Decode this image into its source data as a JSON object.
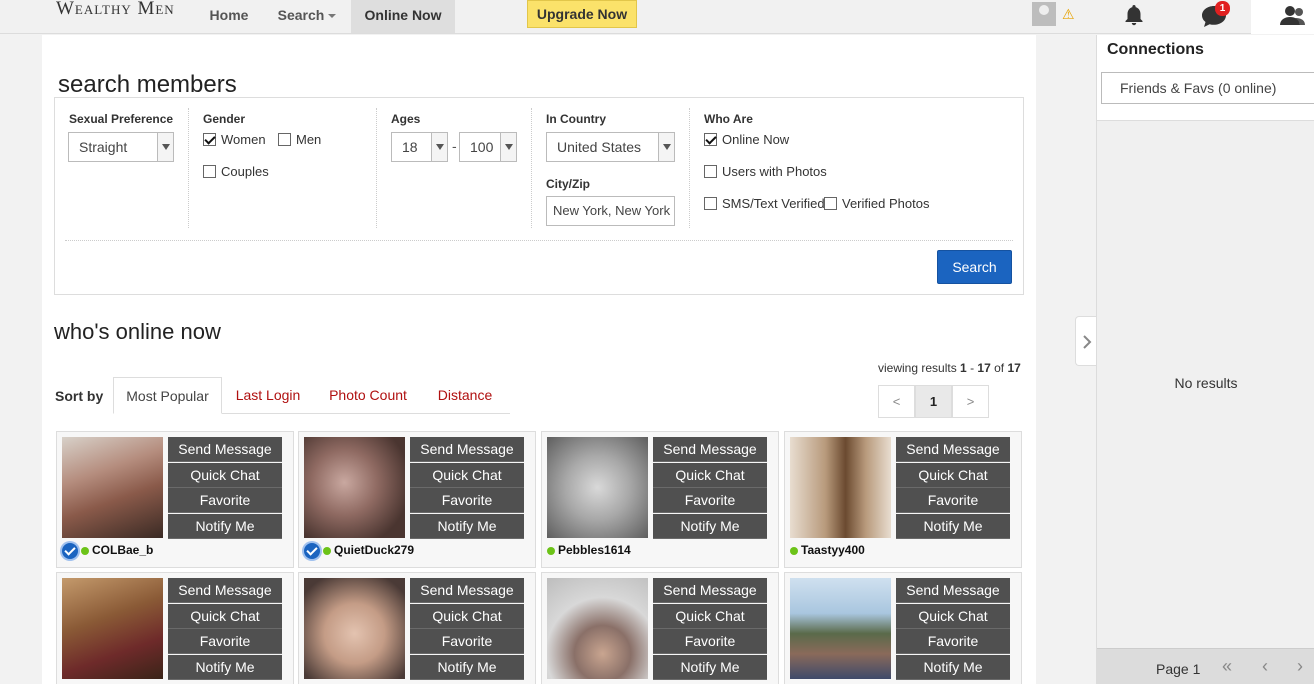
{
  "nav": {
    "logo": "Wealthy Men",
    "home": "Home",
    "search": "Search",
    "online_now": "Online Now",
    "upgrade": "Upgrade Now",
    "message_badge": "1"
  },
  "search": {
    "heading": "search members",
    "sexual_pref_label": "Sexual Preference",
    "sexual_pref_value": "Straight",
    "gender_label": "Gender",
    "gender_women": "Women",
    "gender_men": "Men",
    "gender_couples": "Couples",
    "ages_label": "Ages",
    "age_min": "18",
    "age_max": "100",
    "age_dash": "-",
    "country_label": "In Country",
    "country_value": "United States",
    "city_label": "City/Zip",
    "city_value": "New York, New York",
    "who_label": "Who Are",
    "who_online": "Online Now",
    "who_photos": "Users with Photos",
    "who_sms": "SMS/Text Verified",
    "who_verified_photos": "Verified Photos",
    "button": "Search"
  },
  "results": {
    "heading": "who's online now",
    "viewing_prefix": "viewing results",
    "range_start": "1",
    "range_sep": "-",
    "range_end": "17",
    "of": "of",
    "total": "17",
    "sort_label": "Sort by",
    "sort_tabs": [
      "Most Popular",
      "Last Login",
      "Photo Count",
      "Distance"
    ],
    "pager": {
      "prev": "<",
      "page": "1",
      "next": ">"
    },
    "actions": [
      "Send Message",
      "Quick Chat",
      "Favorite",
      "Notify Me"
    ],
    "members": [
      {
        "name": "COLBae_b",
        "verified": true
      },
      {
        "name": "QuietDuck279",
        "verified": true
      },
      {
        "name": "Pebbles1614",
        "verified": false
      },
      {
        "name": "Taastyy400",
        "verified": false
      },
      {
        "name": "",
        "verified": false
      },
      {
        "name": "",
        "verified": false
      },
      {
        "name": "",
        "verified": false
      },
      {
        "name": "",
        "verified": false
      }
    ]
  },
  "connections": {
    "title": "Connections",
    "filter": "Friends & Favs (0 online)",
    "empty": "No results",
    "page_label": "Page 1"
  },
  "colors": {
    "accent": "#1b64c0",
    "online": "#6cc318",
    "upgrade": "#fbe26a",
    "sort_link": "#b01010"
  }
}
